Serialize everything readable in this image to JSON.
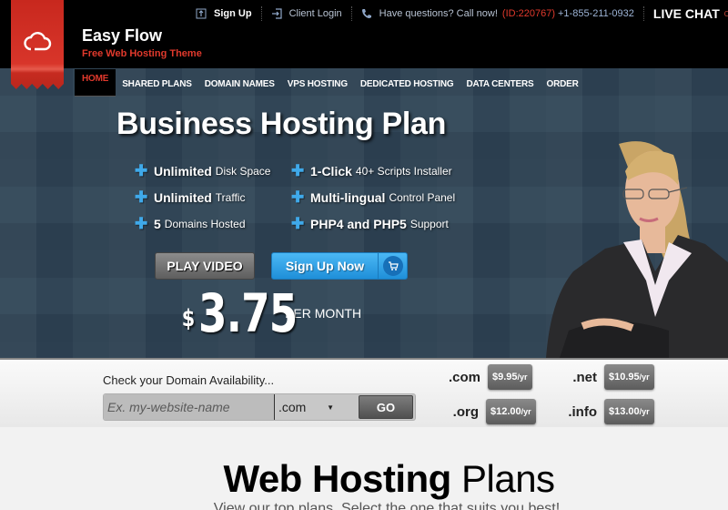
{
  "brand": {
    "title": "Easy Flow",
    "subtitle": "Free Web Hosting Theme",
    "logo_icon": "cloud-icon",
    "accent_color": "#e0392c"
  },
  "topbar": {
    "signup_label": "Sign Up",
    "login_label": "Client Login",
    "call_text": "Have questions? Call now!",
    "call_id": "(ID:220767)",
    "phone": "+1-855-211-0932",
    "livechat_label": "LIVE CHAT",
    "livechat_status": "OFFLINE"
  },
  "nav": {
    "items": [
      {
        "label": "HOME",
        "active": true
      },
      {
        "label": "SHARED PLANS"
      },
      {
        "label": "DOMAIN NAMES"
      },
      {
        "label": "VPS HOSTING"
      },
      {
        "label": "DEDICATED HOSTING"
      },
      {
        "label": "DATA CENTERS"
      },
      {
        "label": "ORDER"
      }
    ]
  },
  "hero": {
    "title": "Business Hosting Plan",
    "features": [
      {
        "bold": "Unlimited",
        "text": "Disk Space"
      },
      {
        "bold": "1-Click",
        "text": "40+ Scripts Installer"
      },
      {
        "bold": "Unlimited",
        "text": "Traffic"
      },
      {
        "bold": "Multi-lingual",
        "text": "Control Panel"
      },
      {
        "bold": "5",
        "text": "Domains Hosted"
      },
      {
        "bold": "PHP4 and PHP5",
        "text": "Support"
      }
    ],
    "play_video_label": "PLAY VIDEO",
    "signup_now_label": "Sign Up Now",
    "price_currency": "$",
    "price_amount": "3.75",
    "price_period": "PER MONTH"
  },
  "domain": {
    "label": "Check your Domain Availability...",
    "input_placeholder": "Ex. my-website-name",
    "input_value": "",
    "selected_tld": ".com",
    "go_label": "GO",
    "tlds": [
      {
        "name": ".com",
        "price": "$9.95",
        "unit": "/yr"
      },
      {
        "name": ".net",
        "price": "$10.95",
        "unit": "/yr"
      },
      {
        "name": ".org",
        "price": "$12.00",
        "unit": "/yr"
      },
      {
        "name": ".info",
        "price": "$13.00",
        "unit": "/yr"
      }
    ]
  },
  "plans": {
    "title_bold": "Web Hosting",
    "title_rest": "Plans",
    "subtitle": "View our top plans. Select the one that suits you best!"
  }
}
